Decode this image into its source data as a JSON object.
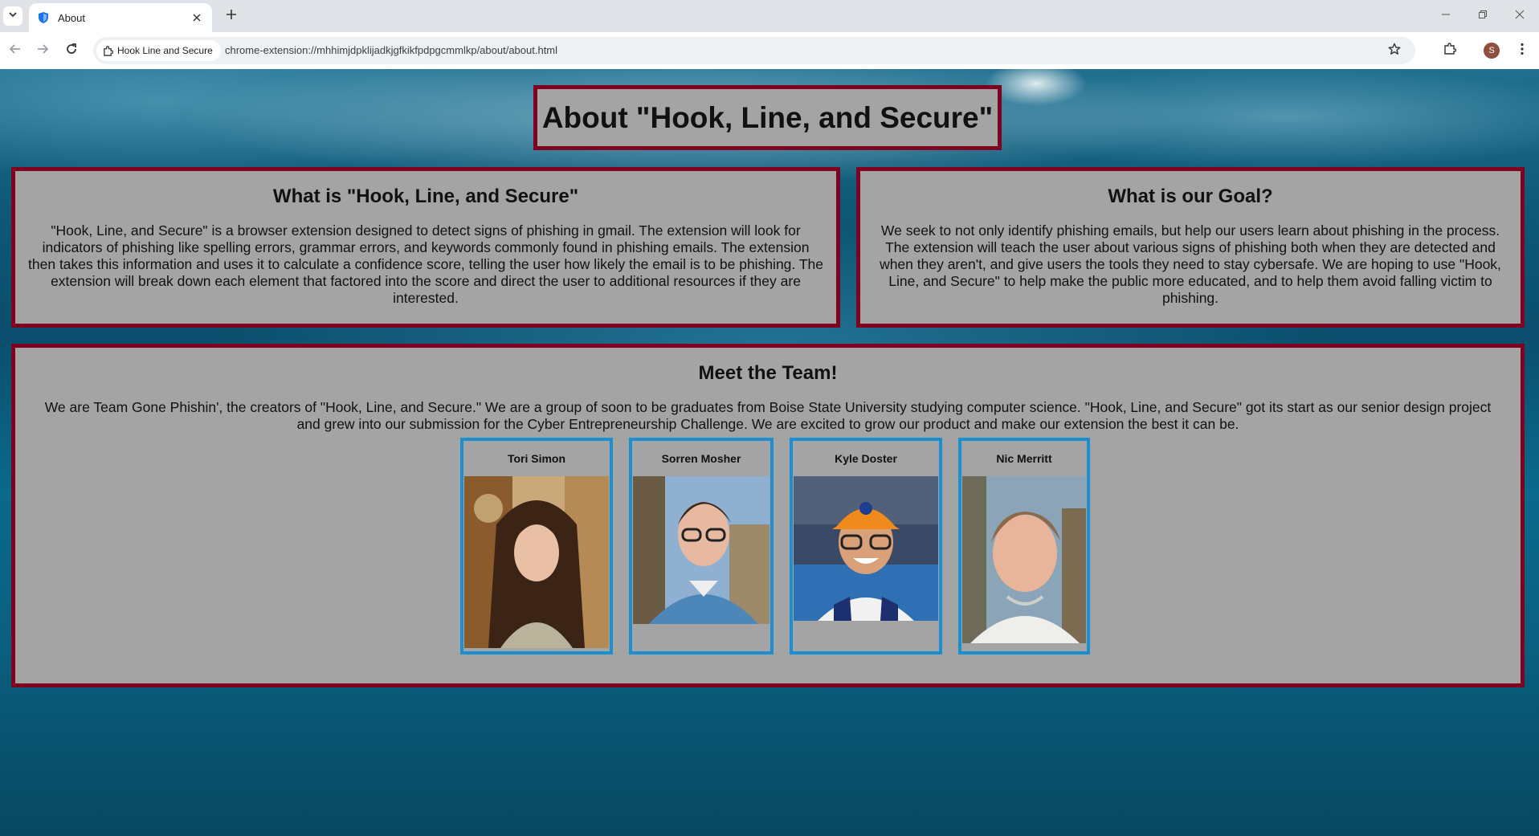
{
  "browser": {
    "tab_title": "About",
    "site_chip": "Hook Line and Secure",
    "url": "chrome-extension://mhhimjdpklijadkjgfkikfpdpgcmmlkp/about/about.html",
    "profile_initial": "S"
  },
  "page": {
    "title": "About \"Hook, Line, and Secure\"",
    "what": {
      "heading": "What is \"Hook, Line, and Secure\"",
      "body": "\"Hook, Line, and Secure\" is a browser extension designed to detect signs of phishing in gmail. The extension will look for indicators of phishing like spelling errors, grammar errors, and keywords commonly found in phishing emails. The extension then takes this information and uses it to calculate a confidence score, telling the user how likely the email is to be phishing. The extension will break down each element that factored into the score and direct the user to additional resources if they are interested."
    },
    "goal": {
      "heading": "What is our Goal?",
      "body": "We seek to not only identify phishing emails, but help our users learn about phishing in the process. The extension will teach the user about various signs of phishing both when they are detected and when they aren't, and give users the tools they need to stay cybersafe. We are hoping to use \"Hook, Line, and Secure\" to help make the public more educated, and to help them avoid falling victim to phishing."
    },
    "team": {
      "heading": "Meet the Team!",
      "body": "We are Team Gone Phishin', the creators of \"Hook, Line, and Secure.\" We are a group of soon to be graduates from Boise State University studying computer science. \"Hook, Line, and Secure\" got its start as our senior design project and grew into our submission for the Cyber Entrepreneurship Challenge. We are excited to grow our product and make our extension the best it can be.",
      "members": [
        {
          "name": "Tori Simon"
        },
        {
          "name": "Sorren Mosher"
        },
        {
          "name": "Kyle Doster"
        },
        {
          "name": "Nic Merritt"
        }
      ]
    }
  },
  "colors": {
    "panel_bg": "#a4a4a4",
    "panel_border": "#800020",
    "card_border": "#1b8fd0"
  }
}
